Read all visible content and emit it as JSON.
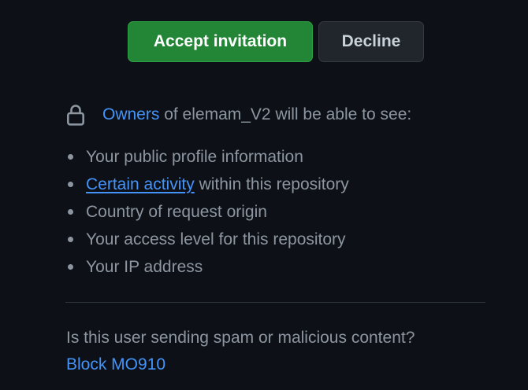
{
  "actions": {
    "accept_label": "Accept invitation",
    "decline_label": "Decline"
  },
  "notice": {
    "icon": "lock-icon",
    "owners_link": "Owners",
    "text": "of elemam_V2 will be able to see:"
  },
  "visibility_items": [
    {
      "text": "Your public profile information"
    },
    {
      "link": "Certain activity",
      "text": "within this repository"
    },
    {
      "text": "Country of request origin"
    },
    {
      "text": "Your access level for this repository"
    },
    {
      "text": "Your IP address"
    }
  ],
  "spam": {
    "question": "Is this user sending spam or malicious content?",
    "block_link": "Block MO910"
  },
  "colors": {
    "background": "#0d1117",
    "accept_green": "#238636",
    "link_blue": "#4493f8",
    "muted_text": "#8d96a0"
  }
}
